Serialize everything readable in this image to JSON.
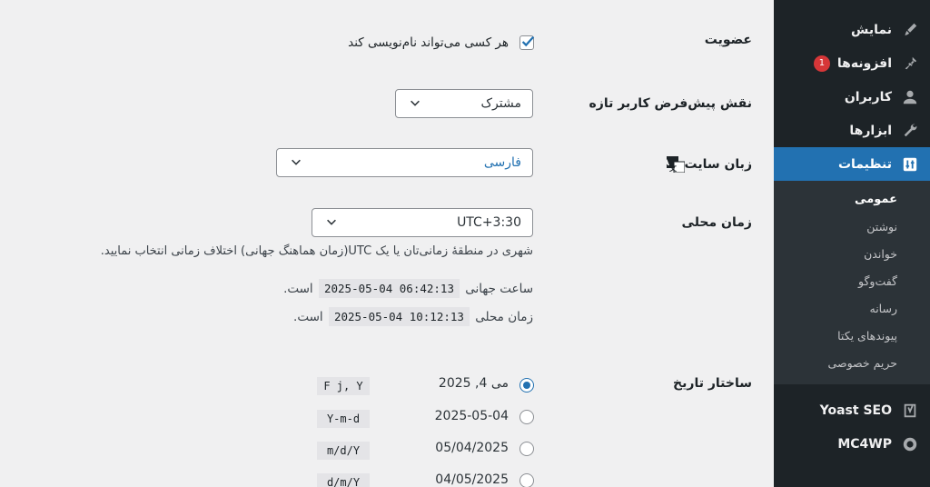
{
  "sidebar": {
    "items": [
      {
        "label": "نمایش",
        "icon": "brush-icon"
      },
      {
        "label": "افزونه‌ها",
        "icon": "plugin-icon",
        "badge": "1"
      },
      {
        "label": "کاربران",
        "icon": "users-icon"
      },
      {
        "label": "ابزارها",
        "icon": "wrench-icon"
      },
      {
        "label": "تنظیمات",
        "icon": "settings-icon"
      }
    ],
    "submenu": [
      "عمومی",
      "نوشتن",
      "خواندن",
      "گفت‌وگو",
      "رسانه",
      "پیوندهای یکتا",
      "حریم خصوصی"
    ],
    "lower": [
      {
        "label": "Yoast SEO",
        "icon": "yoast-icon"
      },
      {
        "label": "MC4WP",
        "icon": "mc4wp-icon"
      }
    ]
  },
  "settings": {
    "membership_label": "عضویت",
    "membership_checkbox": "هر کسی می‌تواند نام‌نویسی کند",
    "default_role_label": "نقش پیش‌فرض کاربر تازه",
    "default_role_value": "مشترک",
    "site_language_label": "زبان سایت",
    "site_language_value": "فارسی",
    "timezone_label": "زمان محلی",
    "timezone_value": "UTC+3:30",
    "timezone_help": "شهری در منطقهٔ زمانی‌تان یا یک UTC(زمان هماهنگ جهانی) اختلاف زمانی انتخاب نمایید.",
    "utc_prefix": "ساعت جهانی",
    "utc_time": "2025-05-04 06:42:13",
    "utc_suffix": "است.",
    "local_prefix": "زمان محلی",
    "local_time": "2025-05-04 10:12:13",
    "local_suffix": "است.",
    "date_format_label": "ساختار تاریخ",
    "date_formats": [
      {
        "display": "می 4, 2025",
        "format": "F j, Y",
        "selected": true
      },
      {
        "display": "2025-05-04",
        "format": "Y-m-d",
        "selected": false
      },
      {
        "display": "05/04/2025",
        "format": "m/d/Y",
        "selected": false
      },
      {
        "display": "04/05/2025",
        "format": "d/m/Y",
        "selected": false
      }
    ]
  },
  "colors": {
    "accent": "#2271b1",
    "sidebar": "#1d2327",
    "badge": "#d63638"
  }
}
